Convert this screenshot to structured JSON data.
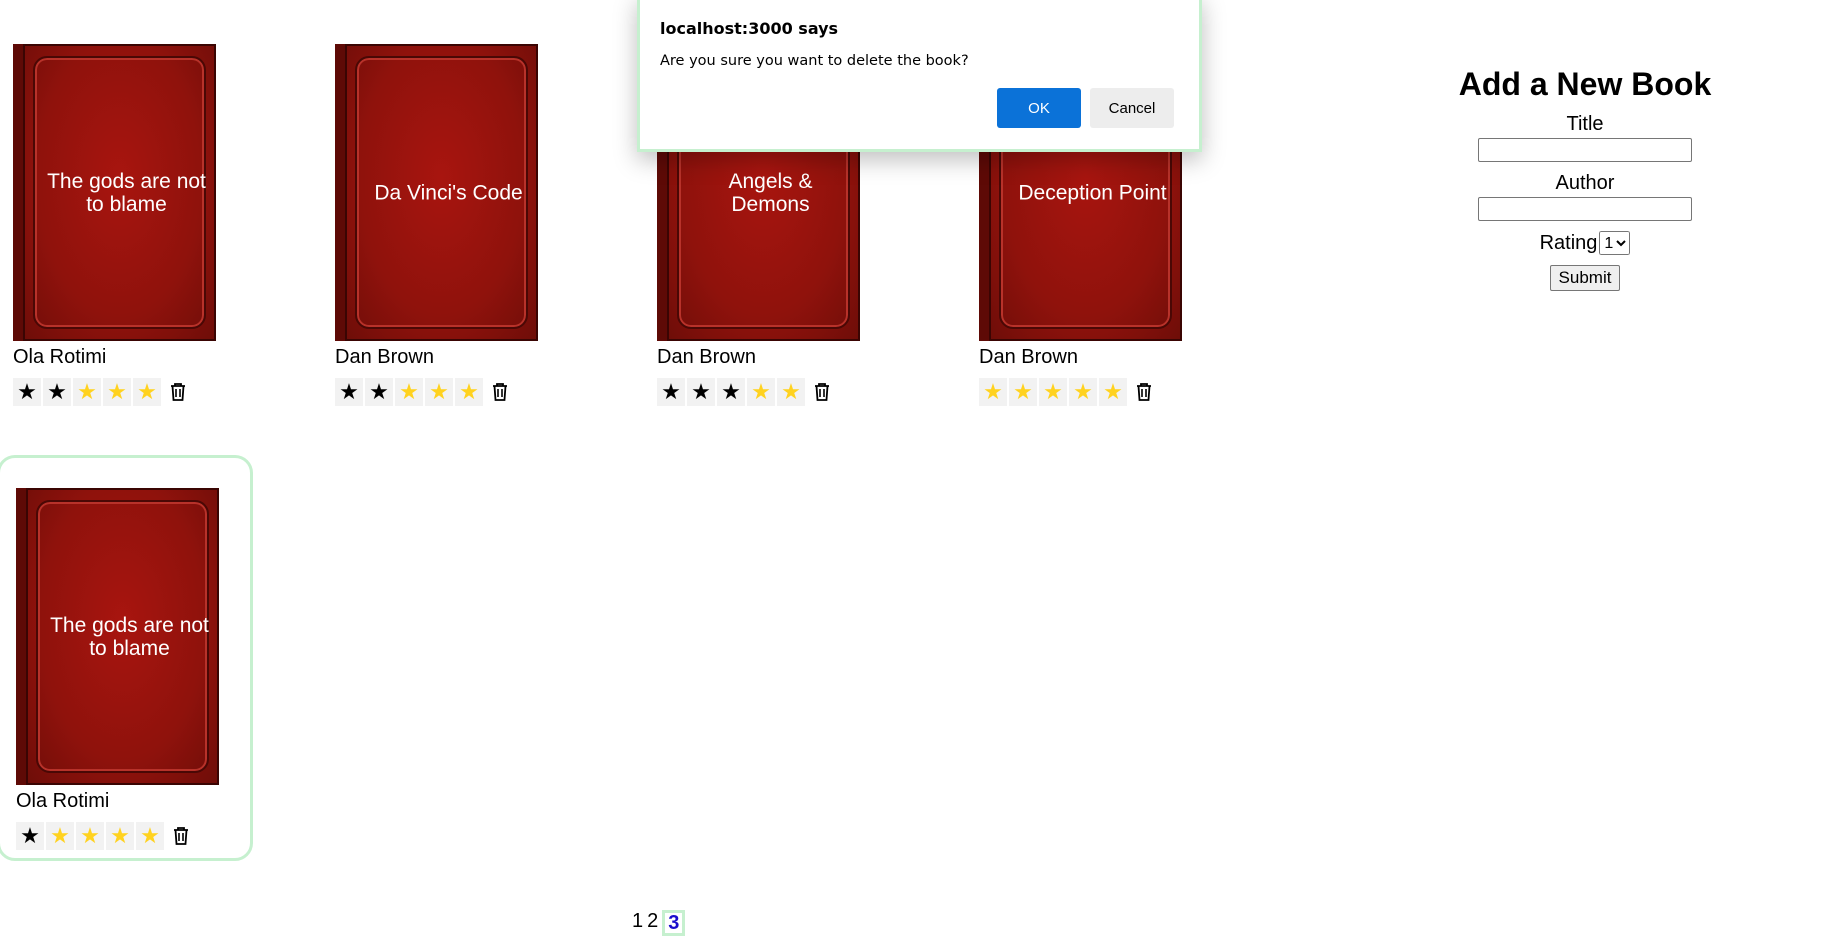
{
  "books": [
    {
      "title": "The gods are not to blame",
      "author": "Ola Rotimi",
      "rating": 2
    },
    {
      "title": "Da Vinci's Code",
      "author": "Dan Brown",
      "rating": 2
    },
    {
      "title": "Angels & Demons",
      "author": "Dan Brown",
      "rating": 3
    },
    {
      "title": "Deception Point",
      "author": "Dan Brown",
      "rating": 0
    },
    {
      "title": "The gods are not to blame",
      "author": "Ola Rotimi",
      "rating": 1
    }
  ],
  "form": {
    "heading": "Add a New Book",
    "title_label": "Title",
    "author_label": "Author",
    "rating_label": "Rating",
    "rating_value": "1",
    "submit_label": "Submit"
  },
  "pagination": {
    "pages": [
      "1",
      "2",
      "3"
    ],
    "current": "3"
  },
  "dialog": {
    "origin": "localhost:3000 says",
    "message": "Are you sure you want to delete the book?",
    "ok_label": "OK",
    "cancel_label": "Cancel"
  },
  "colors": {
    "filled_star": "#000000",
    "empty_star": "#ffd21f",
    "ok_button": "#0b72d8",
    "focus_ring": "#c6f0cf"
  },
  "icons": {
    "delete": "trash-icon",
    "star": "star-icon"
  }
}
